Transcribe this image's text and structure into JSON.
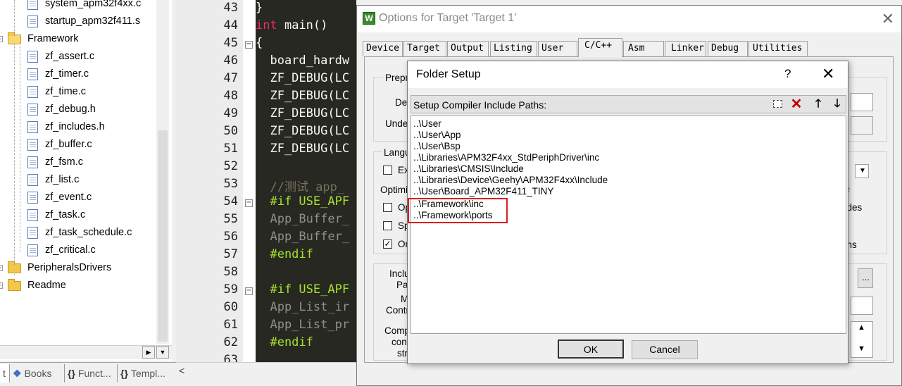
{
  "tree": {
    "files_top": [
      "system_apm32f4xx.c",
      "startup_apm32f411.s"
    ],
    "framework_folder": "Framework",
    "framework_files": [
      "zf_assert.c",
      "zf_timer.c",
      "zf_time.c",
      "zf_debug.h",
      "zf_includes.h",
      "zf_buffer.c",
      "zf_fsm.c",
      "zf_list.c",
      "zf_event.c",
      "zf_task.c",
      "zf_task_schedule.c",
      "zf_critical.c"
    ],
    "other_folders": [
      "PeripheralsDrivers",
      "Readme"
    ],
    "bottom_tabs": [
      {
        "glyph": "",
        "label": "t"
      },
      {
        "glyph": "",
        "label": "Books"
      },
      {
        "glyph": "{}",
        "label": "Funct..."
      },
      {
        "glyph": "{}",
        "label": "Templ..."
      }
    ]
  },
  "editor": {
    "lines": [
      {
        "num": "43",
        "text": "}",
        "style": "white"
      },
      {
        "num": "44",
        "text": "int main()",
        "style": "main"
      },
      {
        "num": "45",
        "text": "{",
        "style": "white"
      },
      {
        "num": "46",
        "text": "  board_hardw",
        "style": "white"
      },
      {
        "num": "47",
        "text": "  ZF_DEBUG(LC",
        "style": "white"
      },
      {
        "num": "48",
        "text": "  ZF_DEBUG(LC",
        "style": "white"
      },
      {
        "num": "49",
        "text": "  ZF_DEBUG(LC",
        "style": "white"
      },
      {
        "num": "50",
        "text": "  ZF_DEBUG(LC",
        "style": "white"
      },
      {
        "num": "51",
        "text": "  ZF_DEBUG(LC",
        "style": "white"
      },
      {
        "num": "52",
        "text": "",
        "style": "white"
      },
      {
        "num": "53",
        "text": "  //测试 app_",
        "style": "comment"
      },
      {
        "num": "54",
        "text": "  #if USE_APF",
        "style": "macro"
      },
      {
        "num": "55",
        "text": "  App_Buffer_",
        "style": "dim"
      },
      {
        "num": "56",
        "text": "  App_Buffer_",
        "style": "dim"
      },
      {
        "num": "57",
        "text": "  #endif",
        "style": "macro"
      },
      {
        "num": "58",
        "text": "",
        "style": "white"
      },
      {
        "num": "59",
        "text": "  #if USE_APF",
        "style": "macro"
      },
      {
        "num": "60",
        "text": "  App_List_ir",
        "style": "dim"
      },
      {
        "num": "61",
        "text": "  App_List_pr",
        "style": "dim"
      },
      {
        "num": "62",
        "text": "  #endif",
        "style": "macro"
      },
      {
        "num": "63",
        "text": "",
        "style": "white"
      }
    ]
  },
  "options": {
    "title": "Options for Target 'Target 1'",
    "tabs": [
      "Device",
      "Target",
      "Output",
      "Listing",
      "User",
      "C/C++",
      "Asm",
      "Linker",
      "Debug",
      "Utilities"
    ],
    "active_tab": "C/C++",
    "bg_labels": {
      "prepro": "Prepro",
      "def": "Def",
      "undef": "Undef",
      "langu": "Langu",
      "ex": "Ex",
      "optimiz": "Optimiz",
      "op": "Op",
      "sp": "Sp",
      "on": "On",
      "inclu": "Inclu",
      "pat": "Pat",
      "m": "M",
      "contr": "Contr",
      "compi": "Compi",
      "cont": "cont",
      "stri": "stri",
      "e": "e",
      "udes": "udes",
      "ons": "ons",
      "dots": "..."
    }
  },
  "folder_setup": {
    "title": "Folder Setup",
    "help": "?",
    "close": "✕",
    "toolbar_label": "Setup Compiler Include Paths:",
    "paths": [
      "..\\User",
      "..\\User\\App",
      "..\\User\\Bsp",
      "..\\Libraries\\APM32F4xx_StdPeriphDriver\\inc",
      "..\\Libraries\\CMSIS\\Include",
      "..\\Libraries\\Device\\Geehy\\APM32F4xx\\Include",
      "..\\User\\Board_APM32F411_TINY",
      "..\\Framework\\inc",
      "..\\Framework\\ports"
    ],
    "ok": "OK",
    "cancel": "Cancel",
    "highlight_color": "#d42020"
  },
  "colors": {
    "editor_bg": "#272822",
    "keyword": "#f92672",
    "macro": "#a6e22e",
    "comment": "#75715e",
    "dim": "#8f908a",
    "text": "#f8f8f2"
  }
}
